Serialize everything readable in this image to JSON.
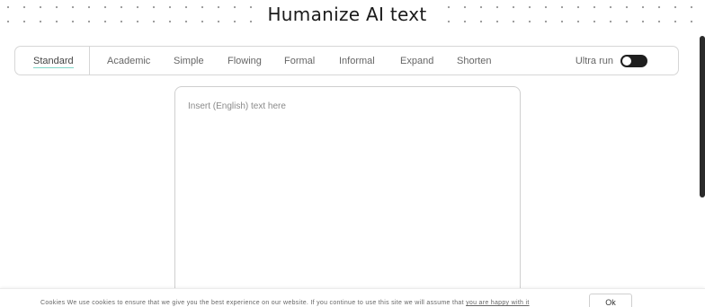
{
  "header": {
    "title": "Humanize AI text"
  },
  "modes": [
    {
      "label": "Standard",
      "active": true
    },
    {
      "label": "Academic",
      "active": false
    },
    {
      "label": "Simple",
      "active": false
    },
    {
      "label": "Flowing",
      "active": false
    },
    {
      "label": "Formal",
      "active": false
    },
    {
      "label": "Informal",
      "active": false
    },
    {
      "label": "Expand",
      "active": false
    },
    {
      "label": "Shorten",
      "active": false
    }
  ],
  "ultra": {
    "label": "Ultra run",
    "enabled": false
  },
  "editor": {
    "placeholder": "Insert (English) text here",
    "value": ""
  },
  "cookie": {
    "text": "Cookies  We use cookies to ensure that we give you the best experience on our website. If you continue to use this site we will assume that ",
    "link": "you are happy with it",
    "ok_label": "Ok"
  },
  "colors": {
    "active_underline": "#7fd6c8",
    "toggle_track": "#1f1f1f"
  }
}
